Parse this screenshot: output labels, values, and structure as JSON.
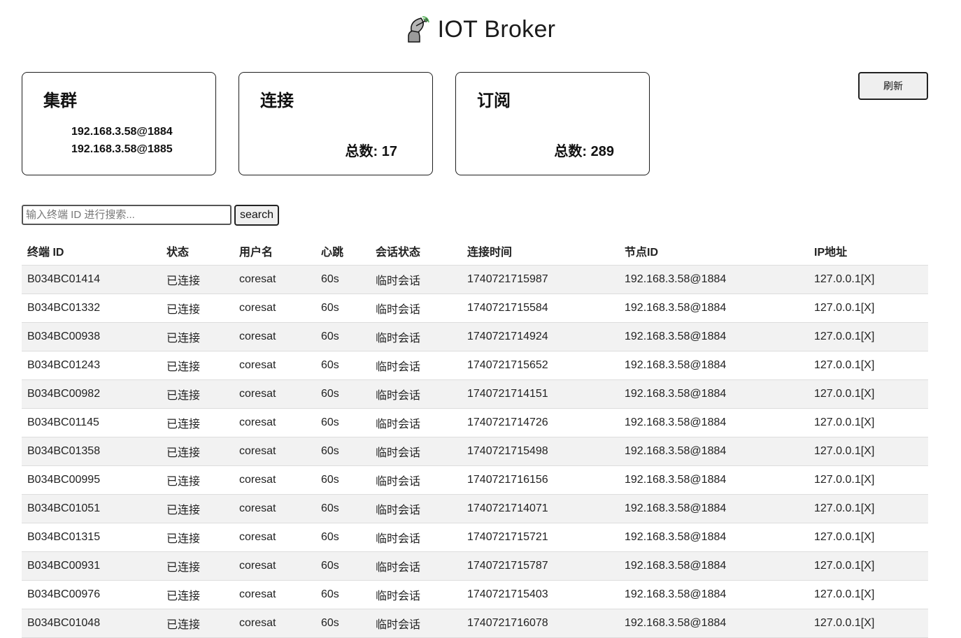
{
  "header": {
    "title": "IOT Broker",
    "logo_icon": "satellite-dish-icon"
  },
  "cards": {
    "cluster": {
      "title": "集群",
      "nodes": [
        "192.168.3.58@1884",
        "192.168.3.58@1885"
      ]
    },
    "connections": {
      "title": "连接",
      "total": "总数: 17"
    },
    "subscriptions": {
      "title": "订阅",
      "total": "总数: 289"
    }
  },
  "toolbar": {
    "refresh_label": "刷新"
  },
  "search": {
    "placeholder": "输入终端 ID 进行搜索...",
    "value": "",
    "button_label": "search"
  },
  "table": {
    "headers": [
      "终端 ID",
      "状态",
      "用户名",
      "心跳",
      "会话状态",
      "连接时间",
      "节点ID",
      "IP地址"
    ],
    "rows": [
      {
        "id": "B034BC01414",
        "status": "已连接",
        "user": "coresat",
        "heartbeat": "60s",
        "session": "临时会话",
        "time": "1740721715987",
        "node": "192.168.3.58@1884",
        "ip": "127.0.0.1",
        "kill": "[X]"
      },
      {
        "id": "B034BC01332",
        "status": "已连接",
        "user": "coresat",
        "heartbeat": "60s",
        "session": "临时会话",
        "time": "1740721715584",
        "node": "192.168.3.58@1884",
        "ip": "127.0.0.1",
        "kill": "[X]"
      },
      {
        "id": "B034BC00938",
        "status": "已连接",
        "user": "coresat",
        "heartbeat": "60s",
        "session": "临时会话",
        "time": "1740721714924",
        "node": "192.168.3.58@1884",
        "ip": "127.0.0.1",
        "kill": "[X]"
      },
      {
        "id": "B034BC01243",
        "status": "已连接",
        "user": "coresat",
        "heartbeat": "60s",
        "session": "临时会话",
        "time": "1740721715652",
        "node": "192.168.3.58@1884",
        "ip": "127.0.0.1",
        "kill": "[X]"
      },
      {
        "id": "B034BC00982",
        "status": "已连接",
        "user": "coresat",
        "heartbeat": "60s",
        "session": "临时会话",
        "time": "1740721714151",
        "node": "192.168.3.58@1884",
        "ip": "127.0.0.1",
        "kill": "[X]"
      },
      {
        "id": "B034BC01145",
        "status": "已连接",
        "user": "coresat",
        "heartbeat": "60s",
        "session": "临时会话",
        "time": "1740721714726",
        "node": "192.168.3.58@1884",
        "ip": "127.0.0.1",
        "kill": "[X]"
      },
      {
        "id": "B034BC01358",
        "status": "已连接",
        "user": "coresat",
        "heartbeat": "60s",
        "session": "临时会话",
        "time": "1740721715498",
        "node": "192.168.3.58@1884",
        "ip": "127.0.0.1",
        "kill": "[X]"
      },
      {
        "id": "B034BC00995",
        "status": "已连接",
        "user": "coresat",
        "heartbeat": "60s",
        "session": "临时会话",
        "time": "1740721716156",
        "node": "192.168.3.58@1884",
        "ip": "127.0.0.1",
        "kill": "[X]"
      },
      {
        "id": "B034BC01051",
        "status": "已连接",
        "user": "coresat",
        "heartbeat": "60s",
        "session": "临时会话",
        "time": "1740721714071",
        "node": "192.168.3.58@1884",
        "ip": "127.0.0.1",
        "kill": "[X]"
      },
      {
        "id": "B034BC01315",
        "status": "已连接",
        "user": "coresat",
        "heartbeat": "60s",
        "session": "临时会话",
        "time": "1740721715721",
        "node": "192.168.3.58@1884",
        "ip": "127.0.0.1",
        "kill": "[X]"
      },
      {
        "id": "B034BC00931",
        "status": "已连接",
        "user": "coresat",
        "heartbeat": "60s",
        "session": "临时会话",
        "time": "1740721715787",
        "node": "192.168.3.58@1884",
        "ip": "127.0.0.1",
        "kill": "[X]"
      },
      {
        "id": "B034BC00976",
        "status": "已连接",
        "user": "coresat",
        "heartbeat": "60s",
        "session": "临时会话",
        "time": "1740721715403",
        "node": "192.168.3.58@1884",
        "ip": "127.0.0.1",
        "kill": "[X]"
      },
      {
        "id": "B034BC01048",
        "status": "已连接",
        "user": "coresat",
        "heartbeat": "60s",
        "session": "临时会话",
        "time": "1740721716078",
        "node": "192.168.3.58@1884",
        "ip": "127.0.0.1",
        "kill": "[X]"
      }
    ]
  }
}
